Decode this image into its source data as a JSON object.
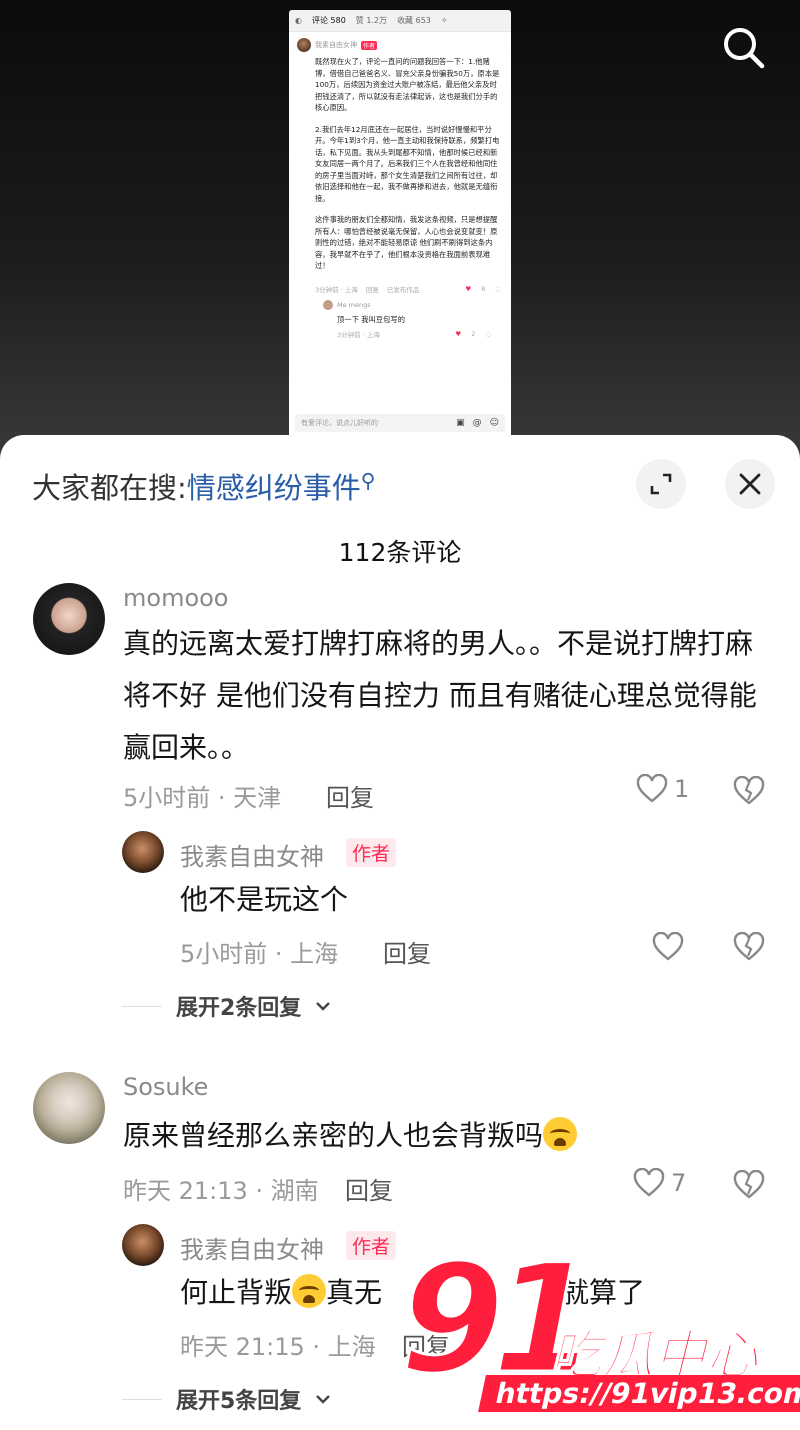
{
  "embedded": {
    "tabs": [
      "评论 580",
      "赞 1.2万",
      "收藏 653"
    ],
    "author_name": "我素自由女神",
    "author_tag": "作者",
    "body": [
      "既然现在火了，评论一直问的问题我回答一下：1.他赌博，借借自己爸爸名义、冒充父亲身份骗我50万，原本是100万，后续因为资金过大账户被冻结，最后他父亲及时把钱还清了，所以就没有走法律起诉，这也是我们分手的核心原因。",
      "2.我们去年12月底还在一起居住，当时说好慢慢和平分开。今年1到3个月，他一直主动和我保持联系，频繁打电话，私下见面。我从头到尾都不知情，他那时候已经和新女友同居一两个月了。后来我们三个人在我曾经和他同住的房子里当面对峙，那个女生清楚我们之间所有过往，却依旧选择和他在一起，我不做再掺和进去，他就是无缝衔接。",
      "这件事我的朋友们全都知情，我发这条视频，只是想提醒所有人：哪怕曾经被说毫无保留，人心也会说变就变！原则性的过错，绝对不能轻易原谅 他们刷不刷得到这条内容，我早就不在乎了，他们根本没资格在我面前表现难过！"
    ],
    "meta_time": "3分钟前 · 上海",
    "meta_reply": "回复",
    "meta_extra": "已发布作品",
    "like_count": "8",
    "reply_user": "Me mengs",
    "reply_text": "顶一下 我叫豆包写的",
    "reply_meta": "3分钟前 · 上海",
    "reply_likes": "2",
    "input_placeholder": "有爱评论，说点儿好听的"
  },
  "sheet": {
    "search_prefix": "大家都在搜:",
    "search_keyword": "情感纠纷事件",
    "comment_count": "112条评论"
  },
  "comments": [
    {
      "user": "momooo",
      "text": "真的远离太爱打牌打麻将的男人。。不是说打牌打麻将不好 是他们没有自控力 而且有赌徒心理总觉得能赢回来。。",
      "meta": "5小时前 · 天津",
      "reply": "回复",
      "likes": "1",
      "author_reply": {
        "user": "我素自由女神",
        "tag": "作者",
        "text": "他不是玩这个",
        "meta": "5小时前 · 上海",
        "reply": "回复"
      },
      "expand": "展开2条回复"
    },
    {
      "user": "Sosuke",
      "text": "原来曾经那么亲密的人也会背叛吗",
      "meta": "昨天 21:13 · 湖南",
      "reply": "回复",
      "likes": "7",
      "author_reply": {
        "user": "我素自由女神",
        "tag": "作者",
        "text_a": "何止背叛",
        "text_b": "真无",
        "text_c": "就算了",
        "meta": "昨天 21:15 · 上海",
        "reply": "回复"
      },
      "expand": "展开5条回复"
    }
  ],
  "watermark": {
    "number": "91",
    "brand": "吃瓜中心",
    "url": "https://91vip13.com"
  }
}
